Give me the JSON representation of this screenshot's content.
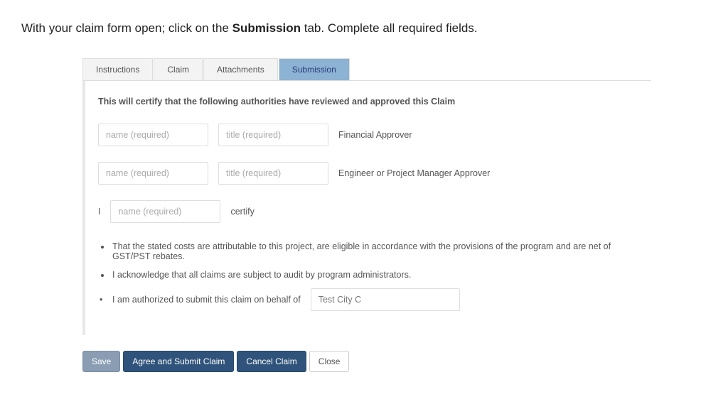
{
  "instruction": {
    "pre": "With your claim form open; click on the ",
    "bold": "Submission",
    "post": " tab. Complete all required fields."
  },
  "tabs": {
    "items": [
      "Instructions",
      "Claim",
      "Attachments",
      "Submission"
    ],
    "activeIndex": 3
  },
  "section": {
    "header": "This will certify that the following authorities have reviewed and approved this Claim",
    "name_placeholder": "name (required)",
    "title_placeholder": "title (required)",
    "approver1_label": "Financial Approver",
    "approver2_label": "Engineer or Project Manager Approver",
    "certify_I": "I",
    "certify_label": "certify",
    "bullets": {
      "b1": "That the stated costs are attributable to this project, are eligible in accordance with the provisions of the program and are net of GST/PST rebates.",
      "b2": "I acknowledge that all claims are subject to audit by program administrators.",
      "b3_text": "I am authorized to submit this claim on behalf of",
      "b3_value": "Test City C"
    }
  },
  "buttons": {
    "save": "Save",
    "submit": "Agree and Submit Claim",
    "cancel": "Cancel Claim",
    "close": "Close"
  }
}
